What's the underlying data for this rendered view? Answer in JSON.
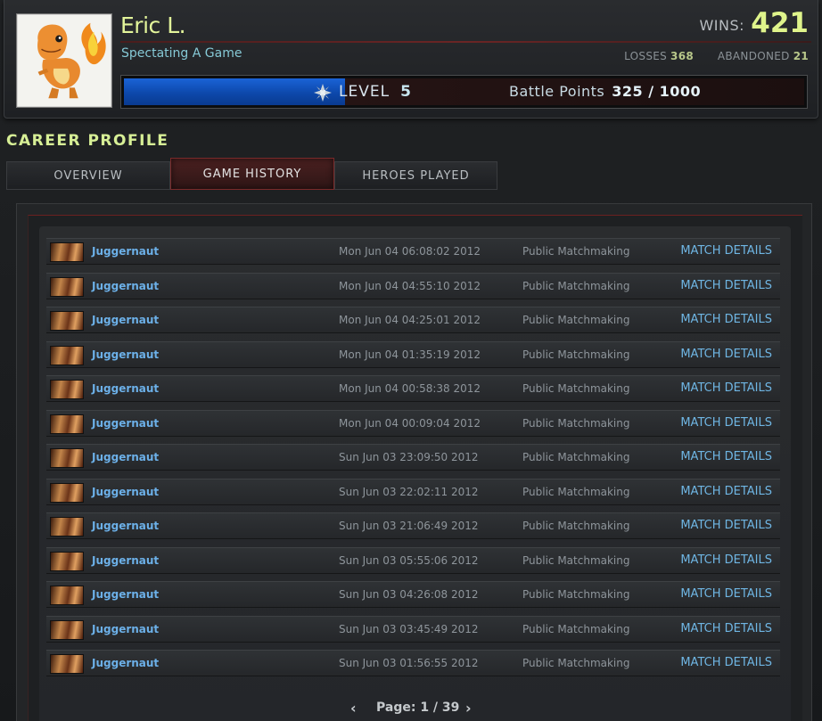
{
  "profile": {
    "name": "Eric L.",
    "status": "Spectating A Game",
    "wins_label": "WINS:",
    "wins": "421",
    "losses_label": "LOSSES",
    "losses": "368",
    "abandoned_label": "ABANDONED",
    "abandoned": "21",
    "level_label": "LEVEL",
    "level": "5",
    "battle_points_label": "Battle Points",
    "battle_points": "325 / 1000",
    "level_progress": 0.325
  },
  "section_title": "CAREER PROFILE",
  "tabs": [
    {
      "label": "OVERVIEW"
    },
    {
      "label": "GAME HISTORY",
      "active": true
    },
    {
      "label": "HEROES PLAYED"
    }
  ],
  "matches": [
    {
      "hero": "Juggernaut",
      "date": "Mon Jun 04 06:08:02 2012",
      "mode": "Public Matchmaking",
      "action": "MATCH DETAILS"
    },
    {
      "hero": "Juggernaut",
      "date": "Mon Jun 04 04:55:10 2012",
      "mode": "Public Matchmaking",
      "action": "MATCH DETAILS"
    },
    {
      "hero": "Juggernaut",
      "date": "Mon Jun 04 04:25:01 2012",
      "mode": "Public Matchmaking",
      "action": "MATCH DETAILS"
    },
    {
      "hero": "Juggernaut",
      "date": "Mon Jun 04 01:35:19 2012",
      "mode": "Public Matchmaking",
      "action": "MATCH DETAILS"
    },
    {
      "hero": "Juggernaut",
      "date": "Mon Jun 04 00:58:38 2012",
      "mode": "Public Matchmaking",
      "action": "MATCH DETAILS"
    },
    {
      "hero": "Juggernaut",
      "date": "Mon Jun 04 00:09:04 2012",
      "mode": "Public Matchmaking",
      "action": "MATCH DETAILS"
    },
    {
      "hero": "Juggernaut",
      "date": "Sun Jun 03 23:09:50 2012",
      "mode": "Public Matchmaking",
      "action": "MATCH DETAILS"
    },
    {
      "hero": "Juggernaut",
      "date": "Sun Jun 03 22:02:11 2012",
      "mode": "Public Matchmaking",
      "action": "MATCH DETAILS"
    },
    {
      "hero": "Juggernaut",
      "date": "Sun Jun 03 21:06:49 2012",
      "mode": "Public Matchmaking",
      "action": "MATCH DETAILS"
    },
    {
      "hero": "Juggernaut",
      "date": "Sun Jun 03 05:55:06 2012",
      "mode": "Public Matchmaking",
      "action": "MATCH DETAILS"
    },
    {
      "hero": "Juggernaut",
      "date": "Sun Jun 03 04:26:08 2012",
      "mode": "Public Matchmaking",
      "action": "MATCH DETAILS"
    },
    {
      "hero": "Juggernaut",
      "date": "Sun Jun 03 03:45:49 2012",
      "mode": "Public Matchmaking",
      "action": "MATCH DETAILS"
    },
    {
      "hero": "Juggernaut",
      "date": "Sun Jun 03 01:56:55 2012",
      "mode": "Public Matchmaking",
      "action": "MATCH DETAILS"
    }
  ],
  "pager": {
    "label": "Page: 1 / 39",
    "prev_icon": "chevron-left-icon",
    "next_icon": "chevron-right-icon"
  },
  "colors": {
    "name": "#e2f49a",
    "wins": "#dff48b",
    "link": "#6fb6e4",
    "level_fill": "#1a63d6",
    "active_tab": "#4a2020"
  }
}
